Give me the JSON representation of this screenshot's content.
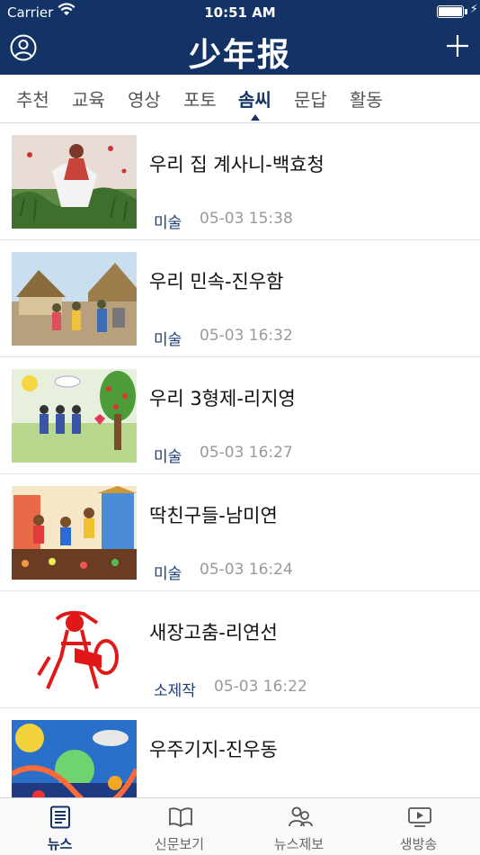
{
  "status": {
    "carrier": "Carrier",
    "time": "10:51 AM"
  },
  "header": {
    "title": "少年报"
  },
  "tabs": [
    {
      "label": "추천"
    },
    {
      "label": "교육"
    },
    {
      "label": "영상"
    },
    {
      "label": "포토"
    },
    {
      "label": "솜씨",
      "active": true
    },
    {
      "label": "문답"
    },
    {
      "label": "활동"
    }
  ],
  "articles": [
    {
      "title": "우리 집 계사니-백효청",
      "category": "미술",
      "date": "05-03 15:38"
    },
    {
      "title": "우리 민속-진우함",
      "category": "미술",
      "date": "05-03 16:32"
    },
    {
      "title": "우리 3형제-리지영",
      "category": "미술",
      "date": "05-03 16:27"
    },
    {
      "title": "딱친구들-남미연",
      "category": "미술",
      "date": "05-03 16:24"
    },
    {
      "title": "새장고춤-리연선",
      "category": "소제작",
      "date": "05-03 16:22"
    },
    {
      "title": "우주기지-진우동",
      "category": "",
      "date": ""
    }
  ],
  "tabbar": [
    {
      "label": "뉴스",
      "icon": "news-icon",
      "active": true
    },
    {
      "label": "신문보기",
      "icon": "newspaper-icon"
    },
    {
      "label": "뉴스제보",
      "icon": "report-icon"
    },
    {
      "label": "생방송",
      "icon": "live-tv-icon"
    }
  ],
  "colors": {
    "brand": "#133266",
    "category": "#1c3f76",
    "date": "#999999"
  }
}
